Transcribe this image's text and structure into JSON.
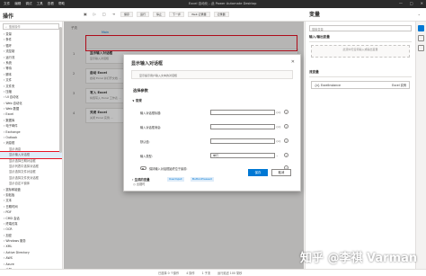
{
  "titlebar": {
    "menu": [
      "文件",
      "编辑",
      "调试",
      "工具",
      "查看",
      "帮助"
    ],
    "title": "Excel 自动化 - 此 Power Automate Desktop",
    "controls": [
      "—",
      "□",
      "✕"
    ]
  },
  "toolbar": {
    "operations_title": "操作",
    "sub_buttons": [
      "保存",
      "运行",
      "停止",
      "下一步",
      "Web 记录器",
      "记录器"
    ],
    "variables_title": "变量",
    "right_label": "⌄"
  },
  "sidebar": {
    "search_placeholder": "搜索操作",
    "items": [
      {
        "label": "› 变量",
        "level": 0,
        "selected": false
      },
      {
        "label": "› 条件",
        "level": 0,
        "selected": false
      },
      {
        "label": "› 循环",
        "level": 0,
        "selected": false
      },
      {
        "label": "› 流控制",
        "level": 0,
        "selected": false
      },
      {
        "label": "› 运行流",
        "level": 0,
        "selected": false
      },
      {
        "label": "› 系统",
        "level": 0,
        "selected": false
      },
      {
        "label": "› 等待",
        "level": 0,
        "selected": false
      },
      {
        "label": "› 脚本",
        "level": 0,
        "selected": false
      },
      {
        "label": "› 文件",
        "level": 0,
        "selected": false
      },
      {
        "label": "› 文件夹",
        "level": 0,
        "selected": false
      },
      {
        "label": "› 压缩",
        "level": 0,
        "selected": false
      },
      {
        "label": "› UI 自动化",
        "level": 0,
        "selected": false
      },
      {
        "label": "› Web 自动化",
        "level": 0,
        "selected": false
      },
      {
        "label": "› Web 数据",
        "level": 0,
        "selected": false
      },
      {
        "label": "› Excel",
        "level": 0,
        "selected": false
      },
      {
        "label": "› 数据库",
        "level": 0,
        "selected": false
      },
      {
        "label": "› 电子邮件",
        "level": 0,
        "selected": false
      },
      {
        "label": "› Exchange",
        "level": 0,
        "selected": false
      },
      {
        "label": "› Outlook",
        "level": 0,
        "selected": false
      },
      {
        "label": "› 消息框",
        "level": 0,
        "selected": false
      },
      {
        "label": "显示消息",
        "level": 1,
        "selected": false
      },
      {
        "label": "显示输入对话框",
        "level": 1,
        "selected": true
      },
      {
        "label": "显示选择日期对话框",
        "level": 1,
        "selected": false
      },
      {
        "label": "显示列表中选择对话框",
        "level": 1,
        "selected": false
      },
      {
        "label": "显示选择文件对话框",
        "level": 1,
        "selected": false
      },
      {
        "label": "显示选择文件夹对话框",
        "level": 1,
        "selected": false
      },
      {
        "label": "显示自定义窗体",
        "level": 1,
        "selected": false
      },
      {
        "label": "› 鼠标和键盘",
        "level": 0,
        "selected": false
      },
      {
        "label": "› 剪贴板",
        "level": 0,
        "selected": false
      },
      {
        "label": "› 文本",
        "level": 0,
        "selected": false
      },
      {
        "label": "› 日期时间",
        "level": 0,
        "selected": false
      },
      {
        "label": "› PDF",
        "level": 0,
        "selected": false
      },
      {
        "label": "› CMD 会话",
        "level": 0,
        "selected": false
      },
      {
        "label": "› 终端仿真",
        "level": 0,
        "selected": false
      },
      {
        "label": "› OCR",
        "level": 0,
        "selected": false
      },
      {
        "label": "› 加密",
        "level": 0,
        "selected": false
      },
      {
        "label": "› Windows 服务",
        "level": 0,
        "selected": false
      },
      {
        "label": "› XML",
        "level": 0,
        "selected": false
      },
      {
        "label": "› Active Directory",
        "level": 0,
        "selected": false
      },
      {
        "label": "› AWS",
        "level": 0,
        "selected": false
      },
      {
        "label": "› Azure",
        "level": 0,
        "selected": false
      },
      {
        "label": "› 认知",
        "level": 0,
        "selected": false
      },
      {
        "label": "› FTP",
        "level": 0,
        "selected": false
      }
    ]
  },
  "canvas": {
    "sub_tabs": [
      "子流",
      "Main"
    ],
    "main_tab": "Main",
    "steps": [
      {
        "num": "1",
        "title": "显示输入对话框",
        "desc": "显示输入对话框"
      },
      {
        "num": "2",
        "title": "启动 Excel",
        "desc": "启动 Excel 并打开文档 ..."
      },
      {
        "num": "3",
        "title": "写入 Excel",
        "desc": "将值写入 Excel 工作表 ..."
      },
      {
        "num": "4",
        "title": "关闭 Excel",
        "desc": "关闭 Excel 实例 ..."
      }
    ]
  },
  "dialog": {
    "title": "显示输入对话框",
    "close": "✕",
    "info": "显示提示用户输入文本的对话框",
    "section": "选择参数",
    "general_group": "∨ 常规",
    "fields": [
      {
        "label": "输入对话框标题:",
        "value": ""
      },
      {
        "label": "输入对话框消息:",
        "value": ""
      },
      {
        "label": "默认值:",
        "value": ""
      },
      {
        "label": "输入类型:",
        "value": "单行"
      }
    ],
    "fx": "{x}",
    "info_icon": "i",
    "toggle_label": "保持输入对话框始终位于最前:",
    "variables_group": "› 生成的变量",
    "chips": [
      "UserInput",
      "ButtonPressed"
    ],
    "save_label": "保存",
    "cancel_label": "取消",
    "footer_link": "◷ 出错时"
  },
  "rightpanel": {
    "search_placeholder": "搜索变量",
    "section_io": "输入/输出变量",
    "io_empty": "此流中无任何输入或输出变量",
    "section_flow": "流变量",
    "flow_vars": [
      {
        "name": "{x} ExcelInstance",
        "type": "Excel 实例"
      }
    ]
  },
  "statusbar": {
    "items": [
      "已选择 0 个操作",
      "4 操作",
      "1 子流",
      "运行延迟 100 毫秒"
    ]
  },
  "watermark": {
    "text": "知乎 @李祺 Varman"
  },
  "colors": {
    "accent": "#0078d4",
    "highlight": "#e81123",
    "titlebar": "#2b2b2b"
  }
}
